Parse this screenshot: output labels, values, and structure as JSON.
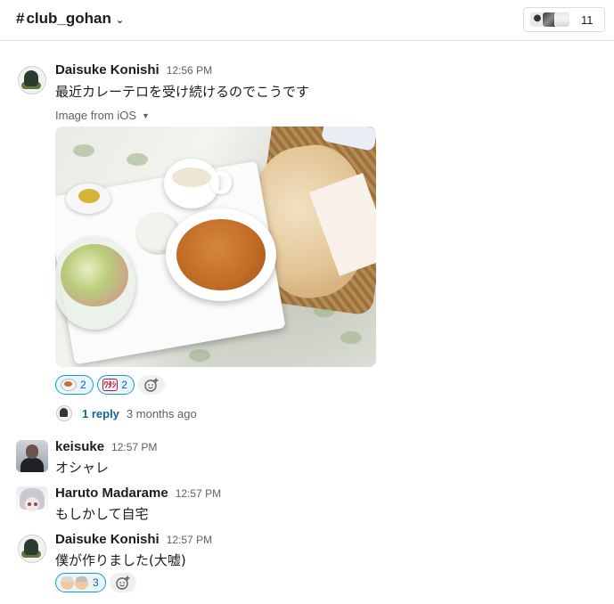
{
  "header": {
    "channel_hash": "#",
    "channel_name": "club_gohan",
    "member_count": "11"
  },
  "messages": [
    {
      "author": "Daisuke Konishi",
      "time": "12:56 PM",
      "text": "最近カレーテロを受け続けるのでこうです",
      "attachment_label": "Image from iOS",
      "reactions": [
        {
          "emoji": "curry-plate-emoji",
          "count": "2"
        },
        {
          "emoji": "text-sticker-emoji",
          "label": "ﾜﾀｼ",
          "count": "2"
        }
      ],
      "thread": {
        "reply_text": "1 reply",
        "ago": "3 months ago"
      }
    },
    {
      "author": "keisuke",
      "time": "12:57 PM",
      "text": "オシャレ"
    },
    {
      "author": "Haruto Madarame",
      "time": "12:57 PM",
      "text": "もしかして自宅"
    },
    {
      "author": "Daisuke Konishi",
      "time": "12:57 PM",
      "text": "僕が作りました(大嘘)",
      "reactions": [
        {
          "emoji": "old-man-faces-emoji",
          "count": "3"
        }
      ]
    }
  ]
}
